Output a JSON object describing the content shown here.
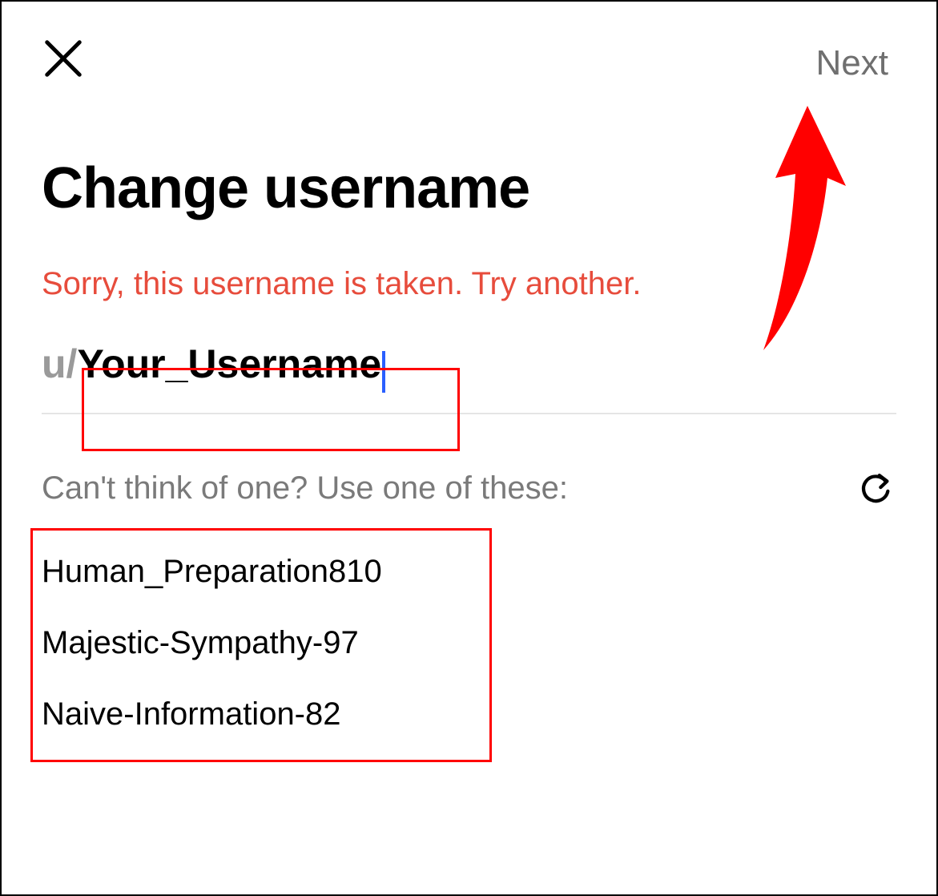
{
  "header": {
    "next_label": "Next"
  },
  "title": "Change username",
  "error_message": "Sorry, this username is taken. Try another.",
  "input": {
    "prefix": "u/",
    "value": "Your_Username"
  },
  "suggestions": {
    "label": "Can't think of one? Use one of these:",
    "items": [
      "Human_Preparation810",
      "Majestic-Sympathy-97",
      "Naive-Information-82"
    ]
  },
  "annotation": {
    "arrow_color": "#ff0000"
  }
}
